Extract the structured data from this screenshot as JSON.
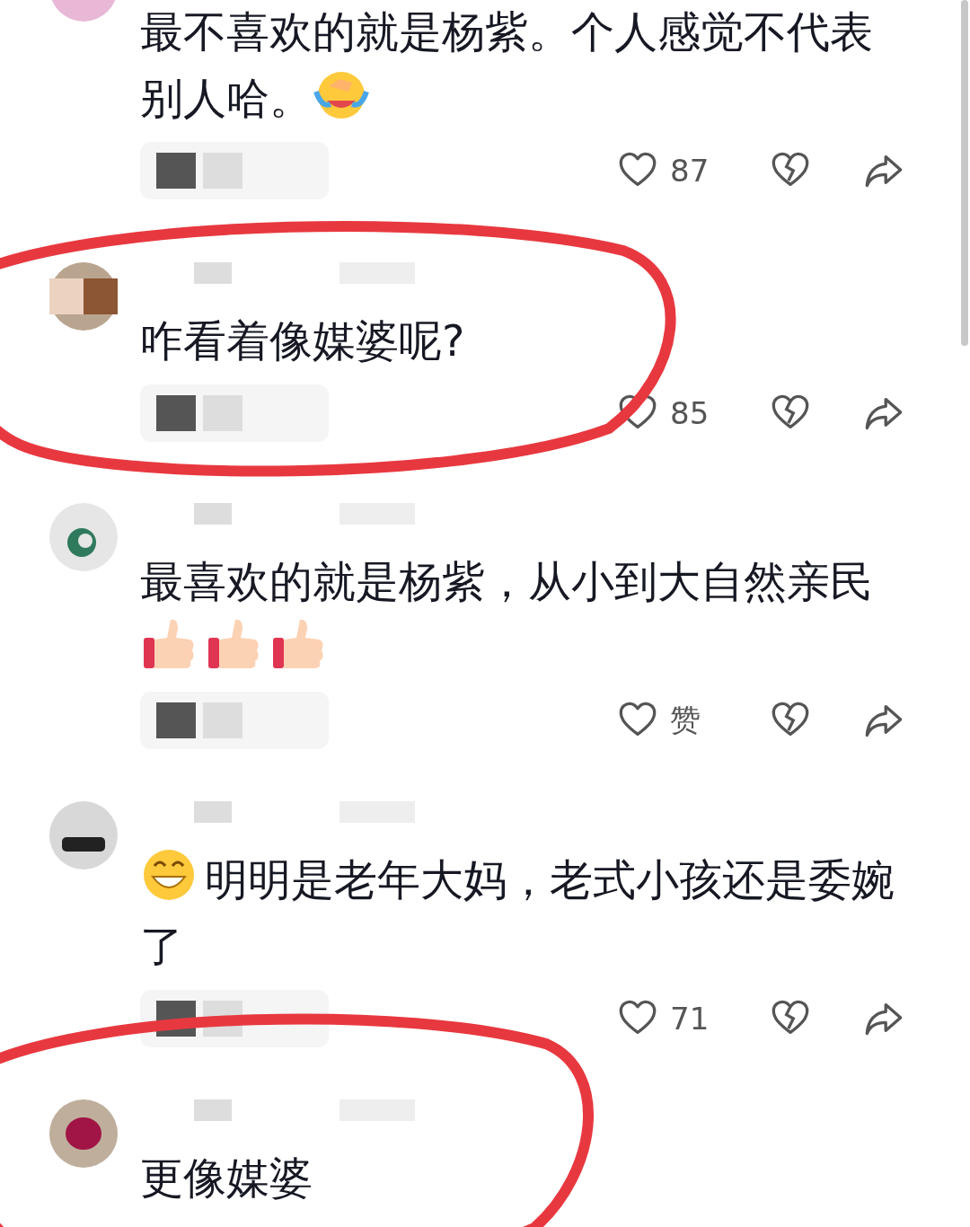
{
  "comments": [
    {
      "content": [
        {
          "kind": "text",
          "text": "最不喜欢的就是杨紫。个人感觉不代表别人哈。"
        },
        {
          "kind": "laugh_emoji"
        }
      ],
      "has_replies": true,
      "likes": "87",
      "liked": false,
      "circled": false
    },
    {
      "content": [
        {
          "kind": "text",
          "text": "咋看着像媒婆呢?"
        }
      ],
      "has_replies": true,
      "likes": "85",
      "liked": false,
      "circled": true
    },
    {
      "content": [
        {
          "kind": "text",
          "text": "最喜欢的就是杨紫，从小到大自然亲民"
        },
        {
          "kind": "thumbs_emoji"
        },
        {
          "kind": "thumbs_emoji"
        },
        {
          "kind": "thumbs_emoji"
        }
      ],
      "has_replies": true,
      "likes": "赞",
      "liked": false,
      "circled": false
    },
    {
      "content": [
        {
          "kind": "grin_emoji"
        },
        {
          "kind": "text",
          "text": "明明是老年大妈，老式小孩还是委婉了"
        }
      ],
      "has_replies": true,
      "likes": "71",
      "liked": false,
      "circled": false
    },
    {
      "content": [
        {
          "kind": "text",
          "text": "更像媒婆"
        }
      ],
      "has_replies": false,
      "circled": true
    }
  ]
}
